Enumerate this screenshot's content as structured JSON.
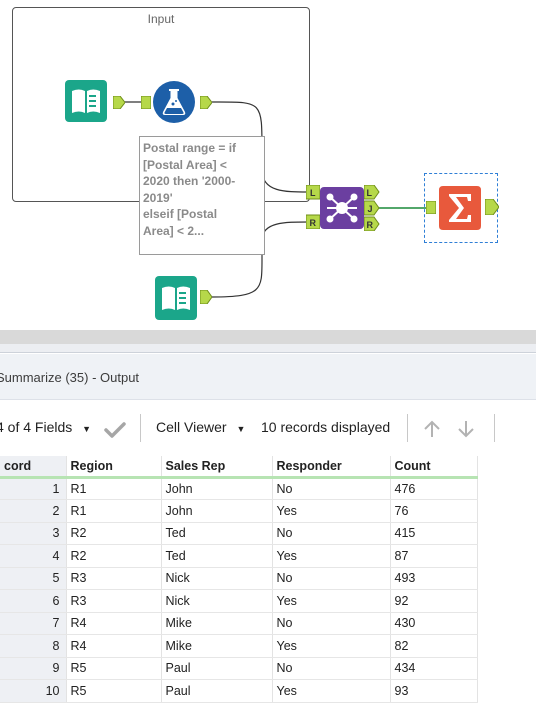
{
  "canvas": {
    "container_title": "Input",
    "annotation_lines": [
      "Postal range = if",
      "[Postal Area] <",
      "2020 then '2000-",
      "2019'",
      "elseif [Postal",
      "Area] < 2..."
    ],
    "tools": [
      {
        "name": "input-data-tool",
        "icon": "book-icon",
        "color": "#1ba68a"
      },
      {
        "name": "formula-tool",
        "icon": "flask-icon",
        "color": "#1d5fa8"
      },
      {
        "name": "join-tool",
        "icon": "join-icon",
        "color": "#6b3fa0",
        "anchors_in": [
          "L",
          "R"
        ],
        "anchors_out": [
          "L",
          "J",
          "R"
        ]
      },
      {
        "name": "summarize-tool",
        "icon": "sigma-icon",
        "color": "#e8593c"
      },
      {
        "name": "input-data-tool-2",
        "icon": "book-icon",
        "color": "#1ba68a"
      }
    ]
  },
  "results": {
    "title": "Summarize (35) - Output",
    "toolbar": {
      "fields": "4 of 4 Fields",
      "cell_viewer": "Cell Viewer",
      "records_displayed": "10 records displayed"
    },
    "columns": [
      "cord",
      "Region",
      "Sales Rep",
      "Responder",
      "Count"
    ],
    "rows": [
      [
        "1",
        "R1",
        "John",
        "No",
        "476"
      ],
      [
        "2",
        "R1",
        "John",
        "Yes",
        "76"
      ],
      [
        "3",
        "R2",
        "Ted",
        "No",
        "415"
      ],
      [
        "4",
        "R2",
        "Ted",
        "Yes",
        "87"
      ],
      [
        "5",
        "R3",
        "Nick",
        "No",
        "493"
      ],
      [
        "6",
        "R3",
        "Nick",
        "Yes",
        "92"
      ],
      [
        "7",
        "R4",
        "Mike",
        "No",
        "430"
      ],
      [
        "8",
        "R4",
        "Mike",
        "Yes",
        "82"
      ],
      [
        "9",
        "R5",
        "Paul",
        "No",
        "434"
      ],
      [
        "10",
        "R5",
        "Paul",
        "Yes",
        "93"
      ]
    ]
  }
}
